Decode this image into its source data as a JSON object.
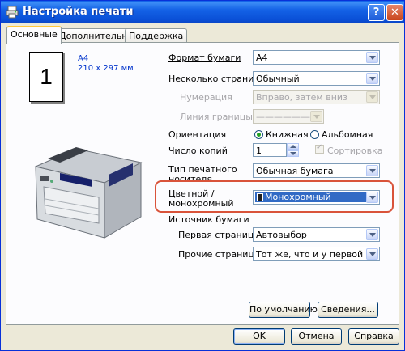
{
  "window": {
    "title": "Настройка печати",
    "help_label": "?",
    "close_label": "✕"
  },
  "tabs": [
    {
      "label": "Основные",
      "active": true
    },
    {
      "label": "Дополнительные",
      "active": false
    },
    {
      "label": "Поддержка",
      "active": false
    }
  ],
  "preview": {
    "page_number": "1",
    "paper_name": "A4",
    "paper_dims": "210 x 297 мм"
  },
  "settings": {
    "paper_size": {
      "label": "Формат бумаги",
      "value": "A4"
    },
    "pages_per_sheet": {
      "label": "Несколько страниц",
      "value": "Обычный"
    },
    "page_order": {
      "label": "Нумерация",
      "value": "Вправо, затем вниз",
      "disabled": true
    },
    "border_line": {
      "label": "Линия границы",
      "value": "———————",
      "disabled": true
    },
    "orientation": {
      "label": "Ориентация",
      "portrait_label": "Книжная",
      "landscape_label": "Альбомная",
      "selected": "Книжная"
    },
    "copies": {
      "label": "Число копий",
      "value": "1",
      "collate_label": "Сортировка",
      "collate_checked": true,
      "collate_disabled": true
    },
    "media_type": {
      "label": "Тип печатного носителя",
      "value": "Обычная бумага"
    },
    "color_mode": {
      "label": "Цветной / монохромный",
      "value": "Монохромный"
    },
    "paper_source": {
      "label": "Источник бумаги",
      "first_page": {
        "label": "Первая страница",
        "value": "Автовыбор"
      },
      "other_pages": {
        "label": "Прочие страницы",
        "value": "Тот же, что и у первой"
      }
    }
  },
  "buttons": {
    "default_label": "По умолчанию",
    "info_label": "Сведения...",
    "ok_label": "OK",
    "cancel_label": "Отмена",
    "help_label": "Справка"
  },
  "colors": {
    "title_bar": "#0a4fd6",
    "dialog_bg": "#ece9d8",
    "highlight_outline": "#d9533a",
    "selection": "#316ac5",
    "preview_text": "#0033cc"
  }
}
